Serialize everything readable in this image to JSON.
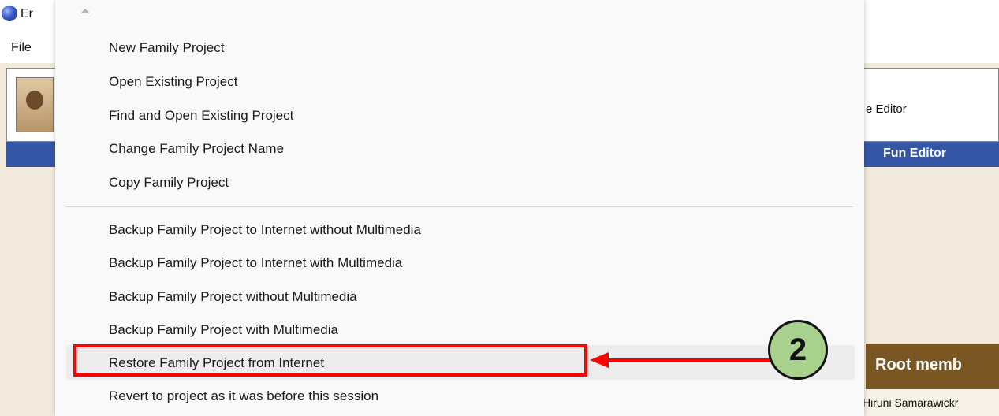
{
  "window": {
    "title_fragment": "Er",
    "file_menu": "File"
  },
  "app": {
    "editor_label_fragment": "e Editor",
    "fun_editor": "Fun Editor",
    "root_member_label": "Root memb",
    "member_name": "Hiruni Samarawickr"
  },
  "menu": {
    "items": [
      "New Family Project",
      "Open Existing Project",
      "Find and Open Existing Project",
      "Change Family Project Name",
      "Copy Family Project",
      "Backup Family Project to Internet without Multimedia",
      "Backup Family Project to Internet with Multimedia",
      "Backup Family Project without Multimedia",
      "Backup Family Project with Multimedia",
      "Restore Family Project from Internet",
      "Revert to project as it was before this session"
    ],
    "highlighted_index": 9
  },
  "annotation": {
    "step_number": "2",
    "highlight_color": "#ff0000",
    "badge_color": "#a9d18e"
  }
}
